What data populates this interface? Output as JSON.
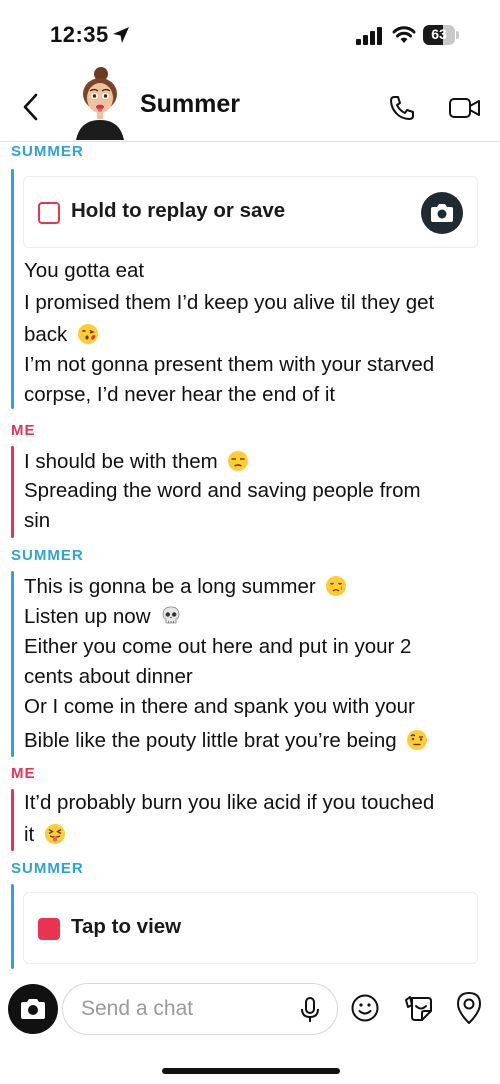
{
  "status_bar": {
    "time": "12:35",
    "battery": "63",
    "battery_level": 0.63
  },
  "header": {
    "title": "Summer"
  },
  "messages": {
    "s1_sender": "SUMMER",
    "s1_media_label": "Hold to replay or save",
    "s1_l1": "You gotta eat",
    "s1_l2": "I promised them I’d keep you alive til they get",
    "s1_l3": "back",
    "s1_l4": "I’m not gonna present them with your starved",
    "s1_l5": "corpse, I’d never hear the end of it",
    "m1_sender": "ME",
    "m1_l1": "I should be with them",
    "m1_l2": "Spreading the word and saving people from",
    "m1_l3": "sin",
    "s2_sender": "SUMMER",
    "s2_l1": "This is gonna be a long summer",
    "s2_l2": "Listen up now",
    "s2_l3": "Either you come out here and put in your 2",
    "s2_l4": "cents about dinner",
    "s2_l5": "Or I come in there and spank you with your",
    "s2_l6": "Bible like the pouty little brat you’re being",
    "m2_sender": "ME",
    "m2_l1": "It’d probably burn you like acid if you touched",
    "m2_l2": "it",
    "s3_sender": "SUMMER",
    "s3_media_label": "Tap to view"
  },
  "composer": {
    "placeholder": "Send a chat"
  },
  "icons": {
    "location": "location-arrow-icon",
    "signal": "cellular-signal-icon",
    "wifi": "wifi-icon",
    "back": "chevron-left-icon",
    "phone": "phone-icon",
    "video": "video-camera-icon",
    "camera": "camera-icon",
    "mic": "microphone-icon",
    "smile": "smiley-icon",
    "sticker": "sticker-icon",
    "bitmoji": "bitmoji-icon",
    "emoji_kiss": "face-blowing-kiss",
    "emoji_unamused": "unamused-face",
    "emoji_cry": "crying-face",
    "emoji_skull": "skull",
    "emoji_raised_eyebrow": "face-with-raised-eyebrow",
    "emoji_tongue": "squinting-face-with-tongue"
  },
  "colors": {
    "summer": "#2ea2d9",
    "me": "#ea3350"
  }
}
